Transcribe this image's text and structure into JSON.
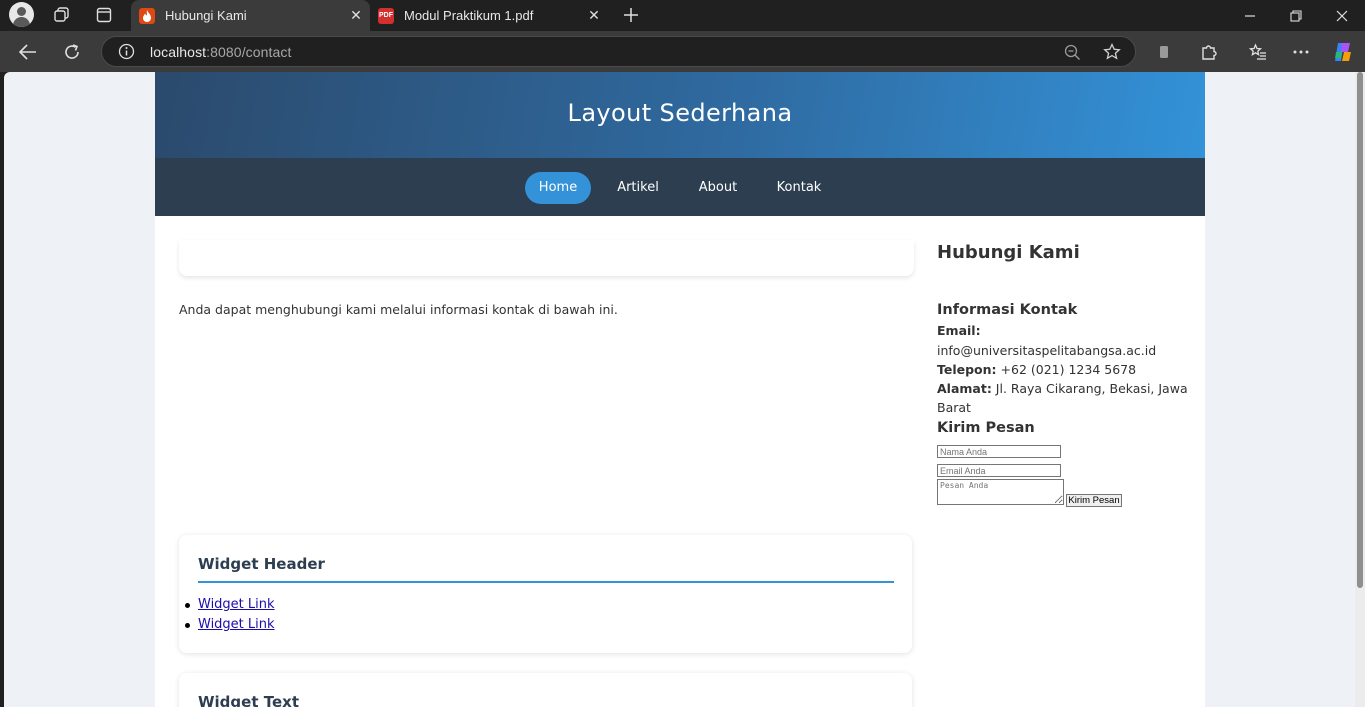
{
  "browser": {
    "tabs": [
      {
        "title": "Hubungi Kami",
        "active": true,
        "favicon": "codeigniter-flame-icon"
      },
      {
        "title": "Modul Praktikum 1.pdf",
        "active": false,
        "favicon": "pdf-icon",
        "favicon_text": "PDF"
      }
    ],
    "url_host": "localhost",
    "url_rest": ":8080/contact",
    "accent": "#3392d8"
  },
  "site": {
    "title": "Layout Sederhana",
    "nav": [
      {
        "label": "Home",
        "active": true
      },
      {
        "label": "Artikel",
        "active": false
      },
      {
        "label": "About",
        "active": false
      },
      {
        "label": "Kontak",
        "active": false
      }
    ]
  },
  "main": {
    "intro": "Anda dapat menghubungi kami melalui informasi kontak di bawah ini.",
    "widget_header": {
      "title": "Widget Header",
      "links": [
        "Widget Link",
        "Widget Link"
      ]
    },
    "widget_text": {
      "title": "Widget Text"
    }
  },
  "sidebar": {
    "title": "Hubungi Kami",
    "contact_heading": "Informasi Kontak",
    "email_label": "Email:",
    "email_value": "info@universitaspelitabangsa.ac.id",
    "phone_label": "Telepon:",
    "phone_value": " +62 (021) 1234 5678",
    "address_label": "Alamat:",
    "address_line1": " Jl. Raya Cikarang, Bekasi, Jawa",
    "address_line2": "Barat",
    "form_heading": "Kirim Pesan",
    "name_placeholder": "Nama Anda",
    "email_placeholder": "Email Anda",
    "message_placeholder": "Pesan Anda",
    "submit_label": "Kirim Pesan"
  }
}
